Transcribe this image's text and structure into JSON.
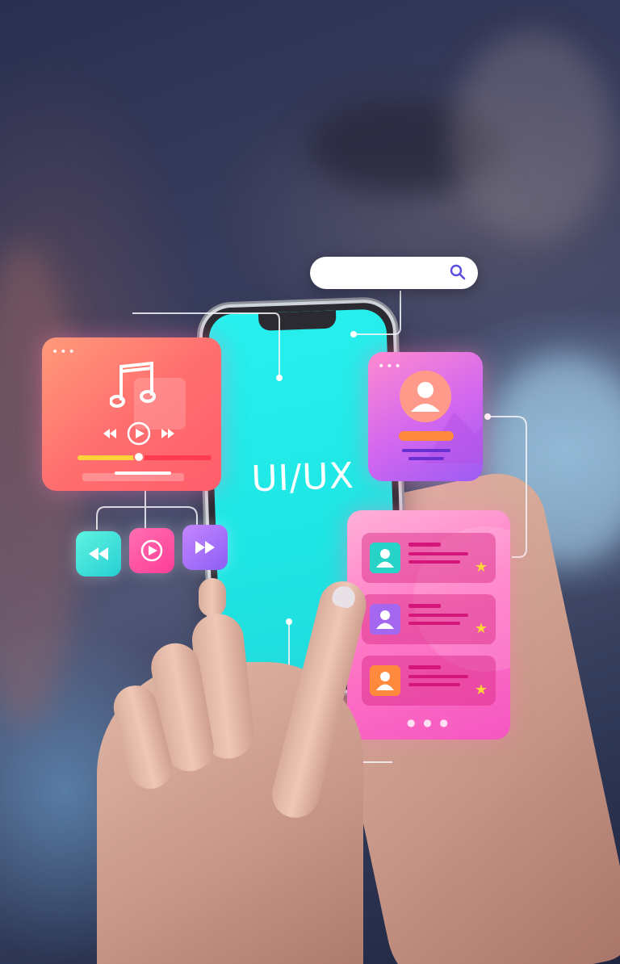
{
  "screen_label": "UI/UX",
  "search": {
    "placeholder": ""
  },
  "music_card": {
    "icon": "music-note-icon",
    "progress": 0.46,
    "controls": [
      "rewind-icon",
      "play-icon",
      "fast-forward-icon"
    ]
  },
  "profile_card": {
    "icon": "user-avatar-icon"
  },
  "list_card": {
    "rows": [
      {
        "avatar_color": "#27d3c6",
        "icon": "user-icon",
        "starred": true
      },
      {
        "avatar_color": "#a468f0",
        "icon": "user-icon",
        "starred": true
      },
      {
        "avatar_color": "#ff8a3d",
        "icon": "user-icon",
        "starred": true
      }
    ]
  },
  "colors": {
    "screen": "#1ee6e4",
    "music_card": "#ff6f6f",
    "profile_card": "#d166f0",
    "list_card": "#ff7ac6",
    "star": "#ffd43b"
  }
}
